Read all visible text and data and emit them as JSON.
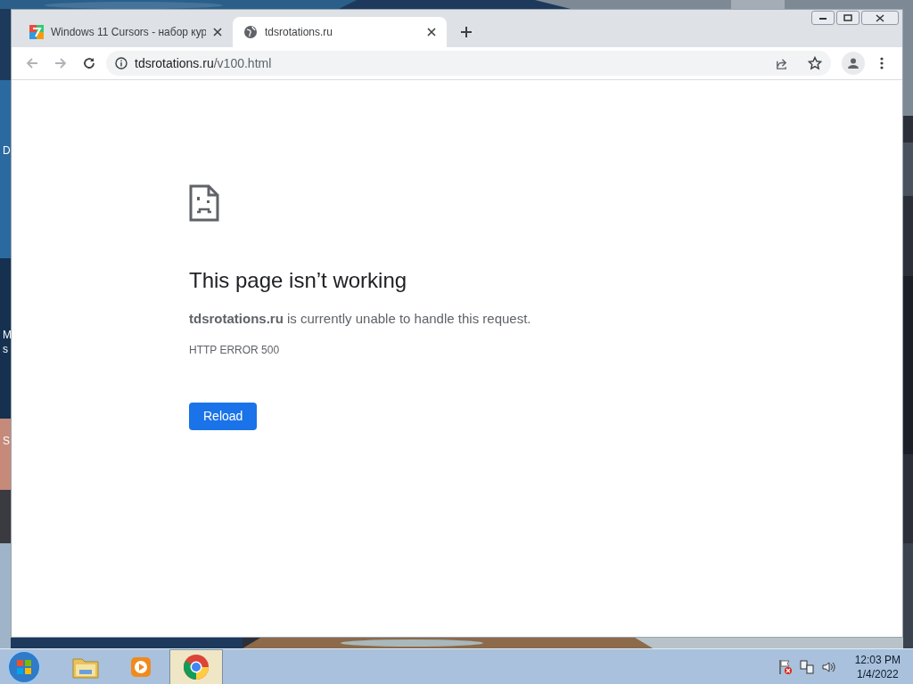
{
  "desktop": {
    "icon_labels": [
      "D",
      "M",
      "s",
      "S"
    ]
  },
  "browser": {
    "tabs": [
      {
        "title": "Windows 11 Cursors - набор кур",
        "kind": "site",
        "selected": false
      },
      {
        "title": "tdsrotations.ru",
        "kind": "globe",
        "selected": true
      }
    ],
    "address": {
      "host": "tdsrotations.ru",
      "path": "/v100.html"
    },
    "error_page": {
      "heading": "This page isn’t working",
      "message": "**tdsrotations.ru** is currently unable to handle this request.",
      "code": "HTTP ERROR 500",
      "button": "Reload"
    }
  },
  "taskbar": {
    "items": [
      {
        "kind": "folder",
        "selected": false
      },
      {
        "kind": "media",
        "selected": false
      },
      {
        "kind": "chrome",
        "selected": true
      }
    ],
    "time": "12:03 PM",
    "date": "1/4/2022"
  }
}
